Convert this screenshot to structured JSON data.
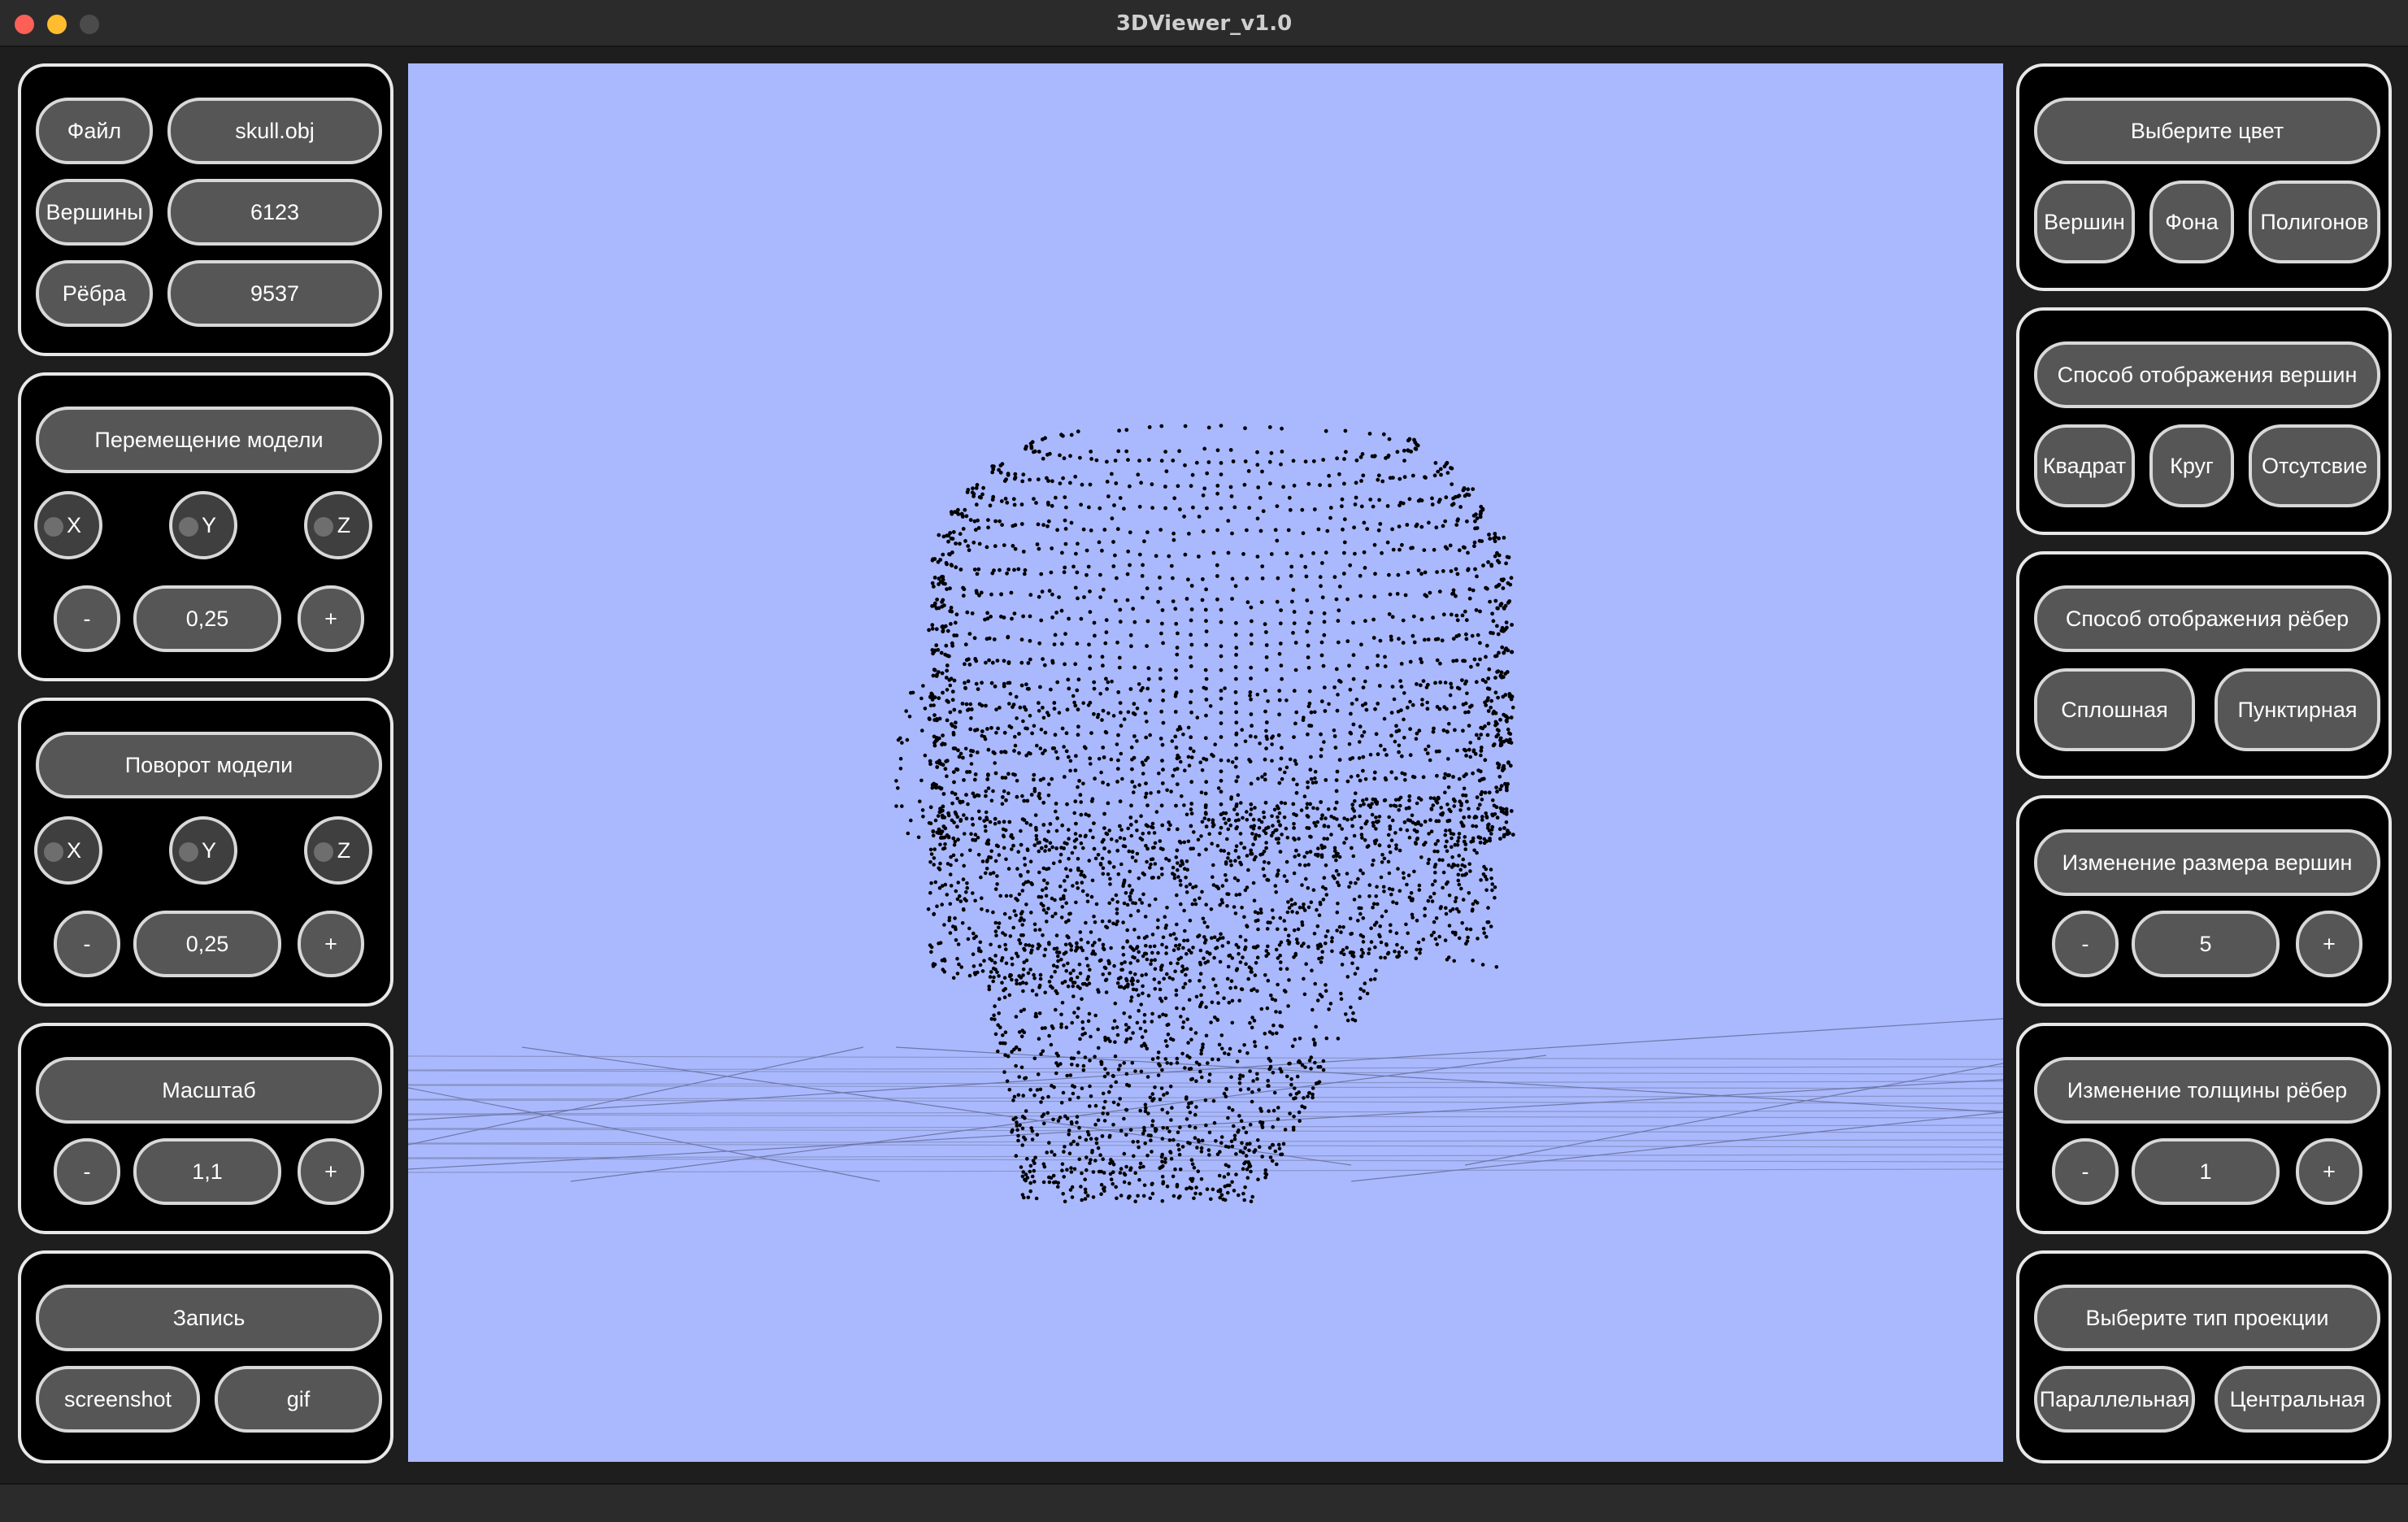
{
  "window": {
    "title": "3DViewer_v1.0"
  },
  "info": {
    "file_label": "Файл",
    "file_value": "skull.obj",
    "vertices_label": "Вершины",
    "vertices_value": "6123",
    "edges_label": "Рёбра",
    "edges_value": "9537"
  },
  "move": {
    "title": "Перемещение модели",
    "x": "X",
    "y": "Y",
    "z": "Z",
    "minus": "-",
    "step": "0,25",
    "plus": "+"
  },
  "rotate": {
    "title": "Поворот модели",
    "x": "X",
    "y": "Y",
    "z": "Z",
    "minus": "-",
    "step": "0,25",
    "plus": "+"
  },
  "scale": {
    "title": "Масштаб",
    "minus": "-",
    "value": "1,1",
    "plus": "+"
  },
  "record": {
    "title": "Запись",
    "screenshot": "screenshot",
    "gif": "gif"
  },
  "color": {
    "title": "Выберите цвет",
    "vertices": "Вершин",
    "background": "Фона",
    "polygons": "Полигонов"
  },
  "vertex_mode": {
    "title": "Способ отображения вершин",
    "square": "Квадрат",
    "circle": "Круг",
    "none": "Отсутсвие"
  },
  "edge_mode": {
    "title": "Способ отображения рёбер",
    "solid": "Сплошная",
    "dashed": "Пунктирная"
  },
  "vertex_size": {
    "title": "Изменение размера вершин",
    "minus": "-",
    "value": "5",
    "plus": "+"
  },
  "edge_width": {
    "title": "Изменение толщины рёбер",
    "minus": "-",
    "value": "1",
    "plus": "+"
  },
  "projection": {
    "title": "Выберите тип проекции",
    "parallel": "Параллельная",
    "central": "Центральная"
  },
  "colors": {
    "viewport_bg": "#aab9fe",
    "button_bg": "#565656",
    "panel_bg": "#000000"
  }
}
